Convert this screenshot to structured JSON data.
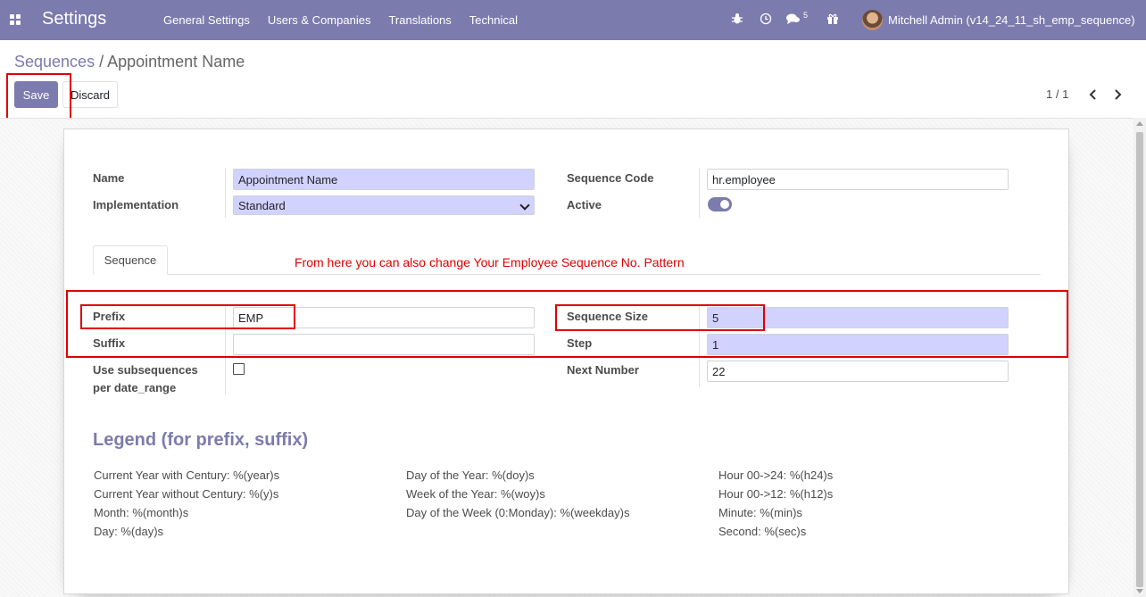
{
  "navbar": {
    "app_title": "Settings",
    "menu": [
      "General Settings",
      "Users & Companies",
      "Translations",
      "Technical"
    ],
    "chat_count": "5",
    "user_name": "Mitchell Admin (v14_24_11_sh_emp_sequence)",
    "icons": [
      "apps-icon",
      "bug-icon",
      "clock-icon",
      "chat-icon",
      "gift-icon"
    ]
  },
  "breadcrumb": {
    "parent": "Sequences",
    "separator": "/",
    "current": "Appointment Name"
  },
  "buttons": {
    "save": "Save",
    "discard": "Discard"
  },
  "pager": {
    "value": "1 / 1"
  },
  "form": {
    "name_label": "Name",
    "name_value": "Appointment Name",
    "implementation_label": "Implementation",
    "implementation_value": "Standard",
    "sequence_code_label": "Sequence Code",
    "sequence_code_value": "hr.employee",
    "active_label": "Active",
    "active_value": true
  },
  "tab": {
    "label": "Sequence"
  },
  "annotation": "From here you can also change Your Employee Sequence No. Pattern",
  "sequence": {
    "prefix_label": "Prefix",
    "prefix_value": "EMP",
    "suffix_label": "Suffix",
    "suffix_value": "",
    "subseq_label_1": "Use subsequences",
    "subseq_label_2": "per date_range",
    "subseq_checked": false,
    "size_label": "Sequence Size",
    "size_value": "5",
    "step_label": "Step",
    "step_value": "1",
    "next_label": "Next Number",
    "next_value": "22"
  },
  "legend": {
    "title": "Legend (for prefix, suffix)",
    "col1": [
      "Current Year with Century: %(year)s",
      "Current Year without Century: %(y)s",
      "Month: %(month)s",
      "Day: %(day)s"
    ],
    "col2": [
      "Day of the Year: %(doy)s",
      "Week of the Year: %(woy)s",
      "Day of the Week (0:Monday): %(weekday)s"
    ],
    "col3": [
      "Hour 00->24: %(h24)s",
      "Hour 00->12: %(h12)s",
      "Minute: %(min)s",
      "Second: %(sec)s"
    ]
  },
  "colors": {
    "brand": "#7c7bad",
    "required_field": "#d2d2ff",
    "annotation": "#e00000"
  }
}
